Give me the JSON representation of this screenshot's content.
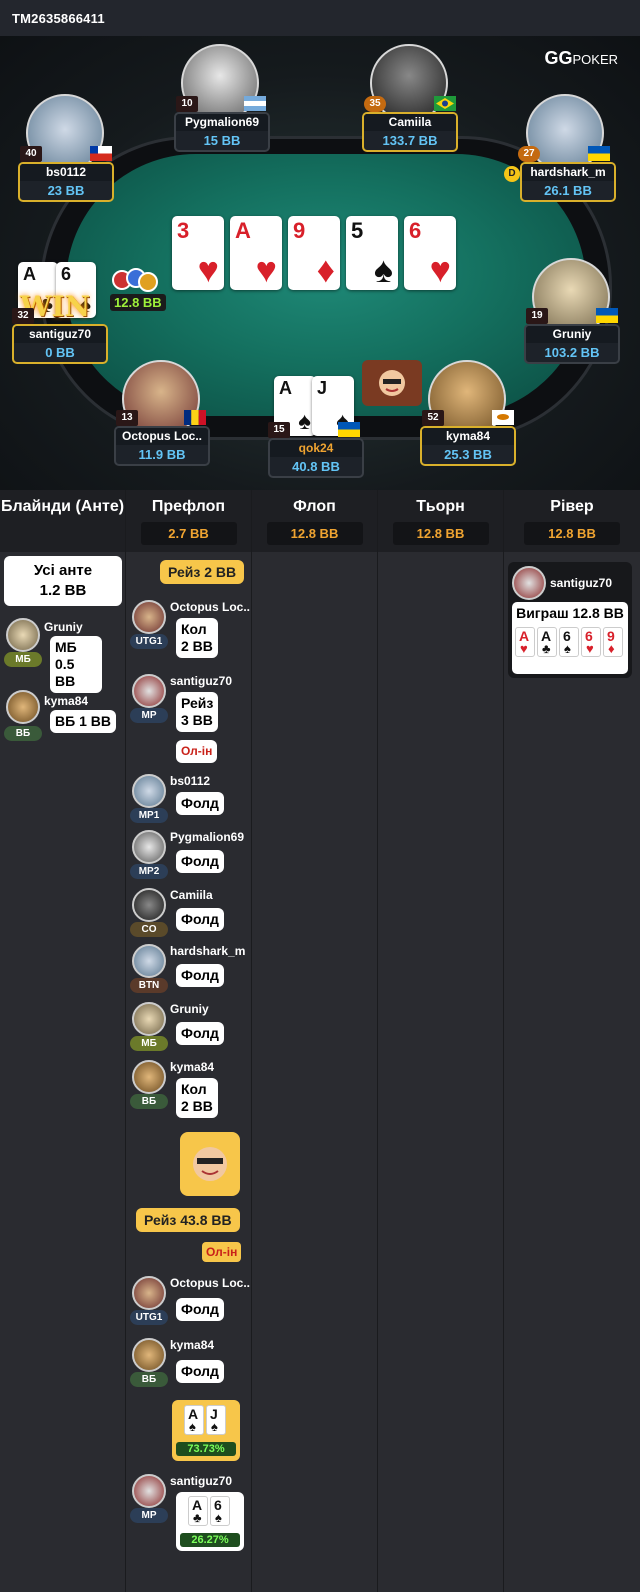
{
  "hand_id": "TM2635866411",
  "logo": {
    "gg": "GG",
    "poker": "POKER"
  },
  "board": [
    {
      "rank": "3",
      "suit": "♥",
      "color": "red"
    },
    {
      "rank": "A",
      "suit": "♥",
      "color": "red"
    },
    {
      "rank": "9",
      "suit": "♦",
      "color": "red"
    },
    {
      "rank": "5",
      "suit": "♠",
      "color": "blk"
    },
    {
      "rank": "6",
      "suit": "♥",
      "color": "red"
    }
  ],
  "pot": "12.8 BB",
  "win_label": "WIN",
  "dealer": "D",
  "seats": {
    "pygmalion": {
      "name": "Pygmalion69",
      "stack": "15 BB",
      "level": "10"
    },
    "camiila": {
      "name": "Camiila",
      "stack": "133.7 BB",
      "level": "35"
    },
    "bs0112": {
      "name": "bs0112",
      "stack": "23 BB",
      "level": "40"
    },
    "hardshark": {
      "name": "hardshark_m",
      "stack": "26.1 BB",
      "level": "27"
    },
    "santiguz": {
      "name": "santiguz70",
      "stack": "0 BB",
      "level": "32"
    },
    "gruniy": {
      "name": "Gruniy",
      "stack": "103.2 BB",
      "level": "19"
    },
    "octopus": {
      "name": "Octopus Loc..",
      "stack": "11.9 BB",
      "level": "13"
    },
    "qok": {
      "name": "qok24",
      "stack": "40.8 BB",
      "level": "15"
    },
    "kyma": {
      "name": "kyma84",
      "stack": "25.3 BB",
      "level": "52"
    }
  },
  "hero_cards": [
    {
      "rank": "A",
      "suit": "♠"
    },
    {
      "rank": "J",
      "suit": "♠"
    }
  ],
  "santiguz_cards": [
    {
      "rank": "A",
      "suit": "♣"
    },
    {
      "rank": "6",
      "suit": "♠"
    }
  ],
  "streets": [
    {
      "title": "Блайнди (Анте)",
      "pot": ""
    },
    {
      "title": "Префлоп",
      "pot": "2.7 BB"
    },
    {
      "title": "Флоп",
      "pot": "12.8 BB"
    },
    {
      "title": "Тьорн",
      "pot": "12.8 BB"
    },
    {
      "title": "Рівер",
      "pot": "12.8 BB"
    }
  ],
  "blinds": {
    "ante_line1": "Усі анте",
    "ante_line2": "1.2 BB",
    "sb_name": "Gruniy",
    "sb_pos": "МБ",
    "sb_line1": "МБ",
    "sb_line2": "0.5 BB",
    "bb_name": "kyma84",
    "bb_pos": "ВБ",
    "bb_text": "ВБ 1 BB"
  },
  "preflop": {
    "raise1": "Рейз 2 BB",
    "a1": {
      "name": "Octopus Loc..",
      "pos": "UTG1",
      "l1": "Кол",
      "l2": "2 BB"
    },
    "a2": {
      "name": "santiguz70",
      "pos": "MP",
      "l1": "Рейз",
      "l2": "3 BB",
      "allin": "Ол-ін"
    },
    "a3": {
      "name": "bs0112",
      "pos": "MP1",
      "text": "Фолд"
    },
    "a4": {
      "name": "Pygmalion69",
      "pos": "MP2",
      "text": "Фолд"
    },
    "a5": {
      "name": "Camiila",
      "pos": "CO",
      "text": "Фолд"
    },
    "a6": {
      "name": "hardshark_m",
      "pos": "BTN",
      "text": "Фолд"
    },
    "a7": {
      "name": "Gruniy",
      "pos": "МБ",
      "text": "Фолд"
    },
    "a8": {
      "name": "kyma84",
      "pos": "ВБ",
      "l1": "Кол",
      "l2": "2 BB"
    },
    "raise2": "Рейз 43.8 BB",
    "allin2": "Ол-ін",
    "a9": {
      "name": "Octopus Loc..",
      "pos": "UTG1",
      "text": "Фолд"
    },
    "a10": {
      "name": "kyma84",
      "pos": "ВБ",
      "text": "Фолд"
    },
    "hero_equity": "73.73%",
    "a11": {
      "name": "santiguz70",
      "pos": "MP"
    },
    "villain_equity": "26.27%"
  },
  "river": {
    "name": "santiguz70",
    "win_text": "Виграш 12.8 BB"
  },
  "win_cards": [
    {
      "rank": "A",
      "suit": "♥",
      "color": "red"
    },
    {
      "rank": "A",
      "suit": "♣",
      "color": "blk"
    },
    {
      "rank": "6",
      "suit": "♠",
      "color": "blk"
    },
    {
      "rank": "6",
      "suit": "♥",
      "color": "red"
    },
    {
      "rank": "9",
      "suit": "♦",
      "color": "red"
    }
  ]
}
